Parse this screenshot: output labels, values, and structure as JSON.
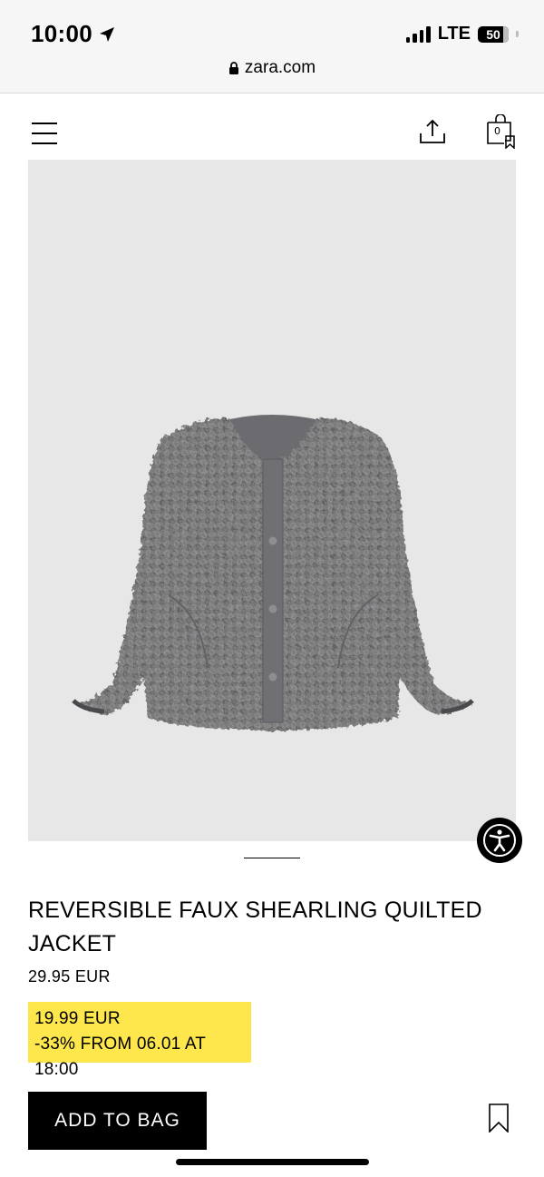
{
  "status_bar": {
    "time": "10:00",
    "network": "LTE",
    "battery": "50"
  },
  "browser": {
    "url": "zara.com"
  },
  "header": {
    "bag_count": "0"
  },
  "product": {
    "title": "REVERSIBLE FAUX SHEARLING QUILTED JACKET",
    "price": "29.95 EUR",
    "sale_price": "19.99 EUR",
    "discount_text": "-33% FROM 06.01 AT 18:00",
    "add_to_bag_label": "ADD TO BAG"
  },
  "colors": {
    "promo_highlight": "#fde74c",
    "image_background": "#e7e7e7",
    "jacket": "#7a7a7c"
  },
  "icons": [
    "location-arrow-icon",
    "lock-icon",
    "menu-icon",
    "share-icon",
    "shopping-bag-icon",
    "accessibility-icon",
    "bookmark-icon"
  ]
}
